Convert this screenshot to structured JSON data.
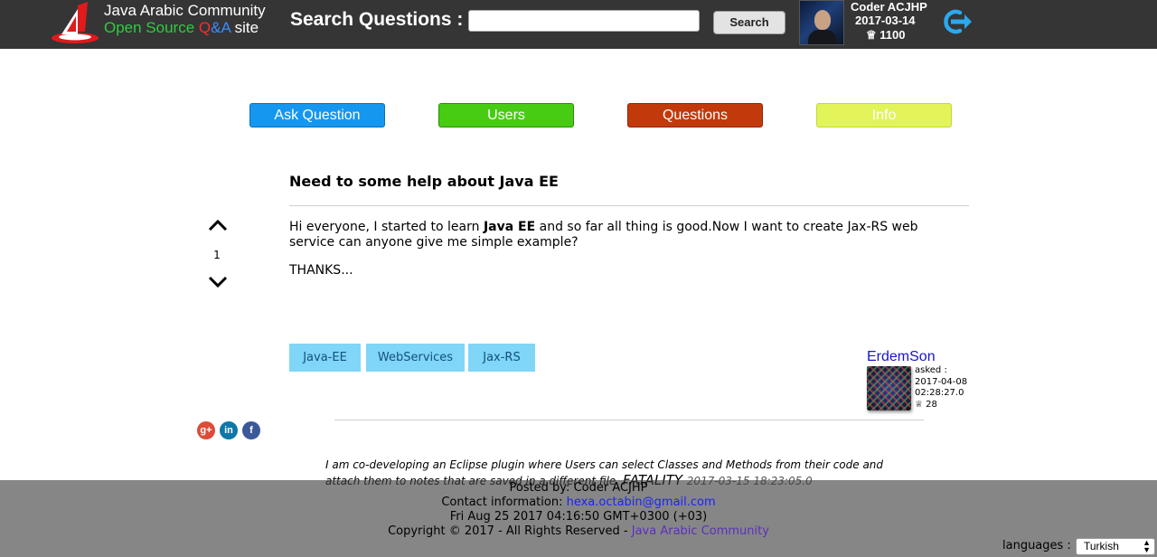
{
  "header": {
    "brand_line1": "Java Arabic Community",
    "brand_line2_prefix": "Open Source ",
    "brand_q": "Q",
    "brand_amp": "&",
    "brand_a": "A",
    "brand_site": " site",
    "search_label": "Search Questions :",
    "search_value": "",
    "search_button": "Search",
    "user_name": "Coder ACJHP",
    "user_date": "2017-03-14",
    "user_reputation": "♕ 1100",
    "icons": [
      "logo-icon",
      "logout-icon"
    ]
  },
  "nav": {
    "ask": "Ask Question",
    "users": "Users",
    "questions": "Questions",
    "info": "Info"
  },
  "question": {
    "title": "Need to some help about Java EE",
    "votes": "1",
    "body_p1_before": "Hi everyone, I started to learn ",
    "body_p1_bold": "Java EE",
    "body_p1_after": " and so far all thing is good.Now I want to create Jax-RS web service can anyone give me simple example?",
    "body_p2": "THANKS...",
    "tags": [
      "Java-EE",
      "WebServices",
      "Jax-RS"
    ],
    "asker": {
      "name": "ErdemSon",
      "asked_label": "asked :",
      "date": "2017-04-08",
      "time": "02:28:27.0",
      "reputation": "♕ 28"
    }
  },
  "share": {
    "google": "g+",
    "linkedin": "in",
    "facebook": "f"
  },
  "comment": {
    "text": "I am co-developing an Eclipse plugin where Users can select Classes and Methods from their code and attach them to notes that are saved in a different file.",
    "user": " FATALITY ",
    "date": "2017-03-15 18:23:05.0"
  },
  "footer": {
    "posted_by": "Posted by: Coder ACJHP",
    "contact_label": "Contact information: ",
    "contact_email": "hexa.octabin@gmail.com",
    "datetime": "Fri Aug 25 2017 04:16:50 GMT+0300 (+03)",
    "copyright": "Copyright © 2017 - All Rights Reserved - ",
    "community_link": "Java Arabic Community",
    "languages_label": "languages :",
    "language_selected": "Turkish"
  },
  "colors": {
    "header_bg": "#353535",
    "ask": "#1597f0",
    "users": "#47cc13",
    "questions": "#c23a0b",
    "info": "#e2f45a",
    "tag": "#7fd6f7"
  }
}
